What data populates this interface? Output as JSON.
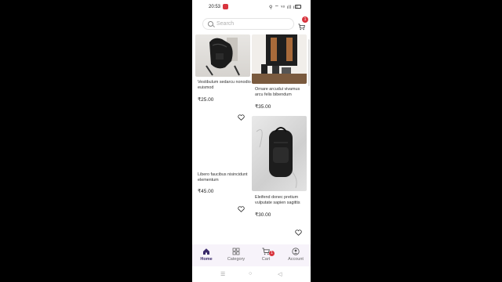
{
  "status_bar": {
    "time": "20:53",
    "signal_text": "⚲ ⌔ ᵛᵒ ıll ıll"
  },
  "search": {
    "placeholder": "Search"
  },
  "cart_badge_count": "1",
  "products": [
    {
      "name": "Vestibulum sedarcu nonodio euismod",
      "price": "₹25.00"
    },
    {
      "name": "Ornare arcudui vivamus arcu felis bibendum",
      "price": "₹35.00"
    },
    {
      "name": "Libero faucibus nisincidunt elementum",
      "price": "₹45.00"
    },
    {
      "name": "Eleifend donec pretium vulputate sapien sagittis",
      "price": "₹30.00"
    }
  ],
  "bottom_nav": {
    "items": [
      {
        "label": "Home"
      },
      {
        "label": "Category"
      },
      {
        "label": "Cart",
        "badge": "1"
      },
      {
        "label": "Account"
      }
    ]
  },
  "system_nav": {
    "menu": "☰",
    "home": "○",
    "back": "◁"
  },
  "colors": {
    "accent": "#3a2a6a",
    "badge": "#d8343e",
    "nav_bg": "#f7f3fa"
  }
}
